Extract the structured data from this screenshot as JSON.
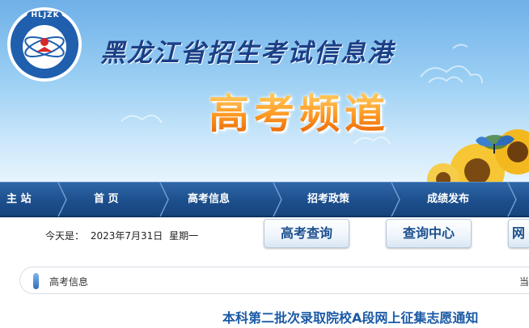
{
  "banner": {
    "logo_badge_text": "HLJZK",
    "logo_ring_text": "黑龙江招生考试信息港",
    "site_title": "黑龙江省招生考试信息港",
    "channel_title": "高考频道"
  },
  "nav": {
    "items": [
      {
        "label": "主 站"
      },
      {
        "label": "首 页"
      },
      {
        "label": "高考信息"
      },
      {
        "label": "招考政策"
      },
      {
        "label": "成绩发布"
      }
    ]
  },
  "toolbar": {
    "date_prefix": "今天是：",
    "date": "2023年7月31日",
    "weekday": "星期一",
    "buttons": [
      {
        "label": "高考查询"
      },
      {
        "label": "查询中心"
      },
      {
        "label": "网"
      }
    ]
  },
  "breadcrumb": {
    "current": "高考信息",
    "right_text": "当"
  },
  "article": {
    "title": "本科第二批次录取院校A段网上征集志愿通知"
  },
  "colors": {
    "nav_bg": "#1d4f8d",
    "title_blue": "#1b3f86",
    "link_blue": "#1a5aa5",
    "channel_orange": "#ff9b24"
  }
}
